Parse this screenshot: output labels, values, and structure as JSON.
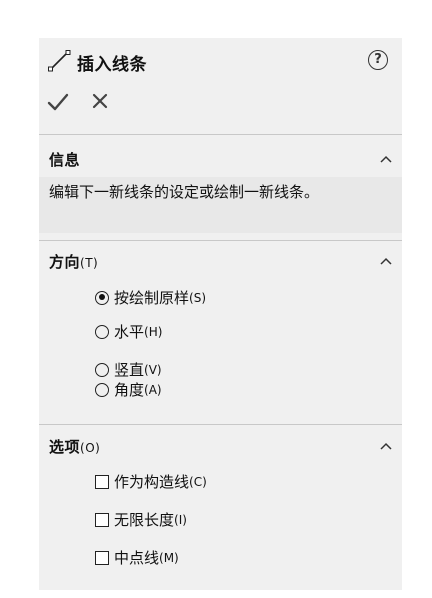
{
  "header": {
    "title": "插入线条",
    "help_label": "?",
    "icons": [
      "line-tool-icon",
      "help-icon",
      "checkmark-icon",
      "close-icon"
    ]
  },
  "sections": {
    "info": {
      "title": "信息",
      "text": "编辑下一新线条的设定或绘制一新线条。"
    },
    "direction": {
      "title": "方向",
      "accel": "(T)",
      "options": [
        {
          "label": "按绘制原样",
          "accel": "(S)",
          "selected": true
        },
        {
          "label": "水平",
          "accel": "(H)",
          "selected": false
        },
        {
          "label": "竖直",
          "accel": "(V)",
          "selected": false
        },
        {
          "label": "角度",
          "accel": "(A)",
          "selected": false
        }
      ]
    },
    "options": {
      "title": "选项",
      "accel": "(O)",
      "items": [
        {
          "label": "作为构造线",
          "accel": "(C)",
          "checked": false
        },
        {
          "label": "无限长度",
          "accel": "(I)",
          "checked": false
        },
        {
          "label": "中点线",
          "accel": "(M)",
          "checked": false
        }
      ]
    }
  },
  "colors": {
    "panel_bg": "#f0f0f0",
    "info_bg": "#e8e8e8",
    "divider": "#c8c8c8",
    "text": "#111111"
  }
}
